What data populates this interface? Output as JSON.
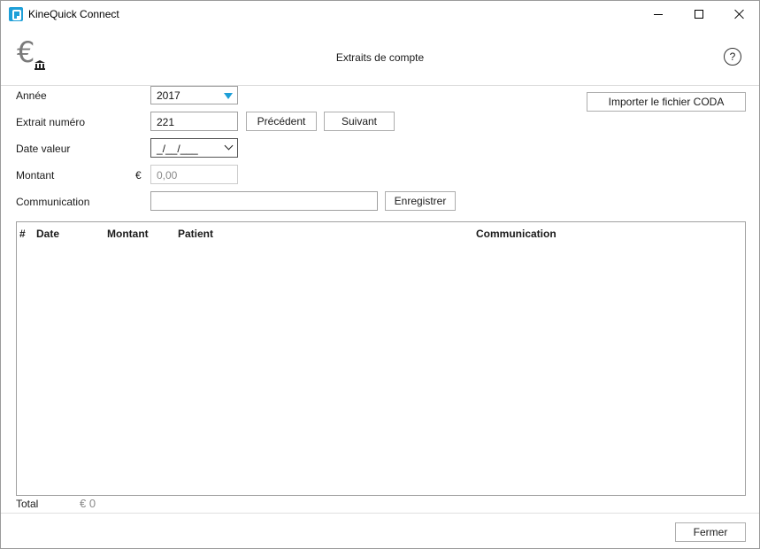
{
  "window": {
    "title": "KineQuick Connect",
    "controls": [
      "minimize",
      "maximize",
      "close"
    ]
  },
  "header": {
    "icon": "euro-bank-icon",
    "title": "Extraits de compte",
    "help_icon": "?"
  },
  "form": {
    "year": {
      "label": "Année",
      "value": "2017"
    },
    "extract_number": {
      "label": "Extrait numéro",
      "value": "221"
    },
    "previous_label": "Précédent",
    "next_label": "Suivant",
    "date_value": {
      "label": "Date valeur",
      "value": "_/__/___"
    },
    "amount": {
      "label": "Montant",
      "currency": "€",
      "placeholder": "0,00"
    },
    "communication": {
      "label": "Communication",
      "value": ""
    },
    "save_label": "Enregistrer",
    "import_coda_label": "Importer le fichier CODA"
  },
  "table": {
    "columns": [
      "#",
      "Date",
      "Montant",
      "Patient",
      "Communication"
    ],
    "rows": []
  },
  "footer": {
    "total_label": "Total",
    "total_value": "€ 0",
    "close_label": "Fermer"
  },
  "colors": {
    "accent": "#1e9fd8",
    "border": "#a0a0a0",
    "muted_text": "#8a8a8a"
  }
}
